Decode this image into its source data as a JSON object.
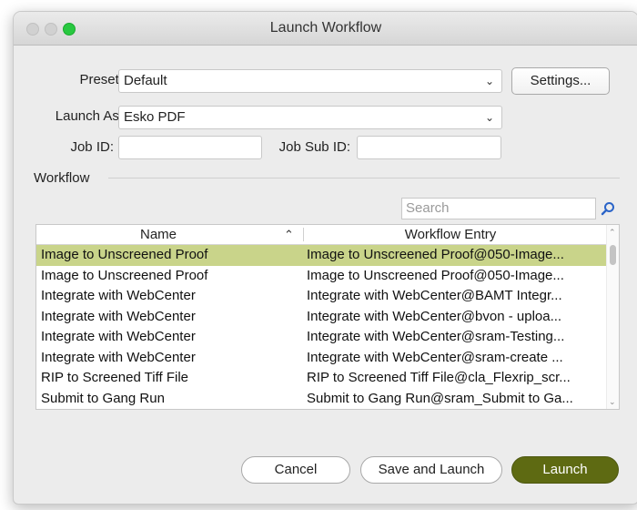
{
  "window": {
    "title": "Launch Workflow"
  },
  "form": {
    "preset_label": "Preset:",
    "preset_value": "Default",
    "settings_button": "Settings...",
    "launch_as_label": "Launch As:",
    "launch_as_value": "Esko PDF",
    "job_id_label": "Job ID:",
    "job_id_value": "",
    "job_sub_id_label": "Job Sub ID:",
    "job_sub_id_value": ""
  },
  "workflow": {
    "group_label": "Workflow",
    "search_placeholder": "Search",
    "columns": [
      "Name",
      "Workflow Entry"
    ],
    "rows": [
      {
        "name": "Image to Unscreened Proof",
        "entry": "Image to Unscreened Proof@050-Image...",
        "selected": true
      },
      {
        "name": "Image to Unscreened Proof",
        "entry": "Image to Unscreened Proof@050-Image...",
        "selected": false
      },
      {
        "name": "Integrate with WebCenter",
        "entry": "Integrate with WebCenter@BAMT Integr...",
        "selected": false
      },
      {
        "name": "Integrate with WebCenter",
        "entry": "Integrate with WebCenter@bvon - uploa...",
        "selected": false
      },
      {
        "name": "Integrate with WebCenter",
        "entry": "Integrate with WebCenter@sram-Testing...",
        "selected": false
      },
      {
        "name": "Integrate with WebCenter",
        "entry": "Integrate with WebCenter@sram-create ...",
        "selected": false
      },
      {
        "name": "RIP to Screened Tiff File",
        "entry": "RIP to Screened Tiff File@cla_Flexrip_scr...",
        "selected": false
      },
      {
        "name": "Submit to Gang Run",
        "entry": "Submit to Gang Run@sram_Submit to Ga...",
        "selected": false
      }
    ]
  },
  "buttons": {
    "cancel": "Cancel",
    "save_and_launch": "Save and Launch",
    "launch": "Launch"
  },
  "colors": {
    "accent": "#5e6a12",
    "selection": "#c9d48a",
    "search_icon": "#2a64c8"
  },
  "icons": {
    "dropdown": "chevron-down-icon",
    "search": "magnifier-icon",
    "sort": "chevron-up-icon"
  }
}
